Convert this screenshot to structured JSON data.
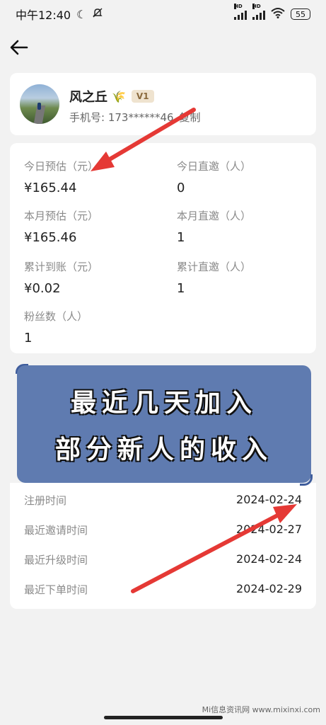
{
  "status_bar": {
    "time": "中午12:40",
    "hd1": "HD",
    "hd2": "HD",
    "battery": "55"
  },
  "profile": {
    "nickname": "风之丘",
    "level": "V1",
    "phone_label": "手机号: 173******46",
    "copy_label": "复制"
  },
  "stats": {
    "today_estimate_label": "今日预估（元）",
    "today_estimate_value": "¥165.44",
    "today_invite_label": "今日直邀（人）",
    "today_invite_value": "0",
    "month_estimate_label": "本月预估（元）",
    "month_estimate_value": "¥165.46",
    "month_invite_label": "本月直邀（人）",
    "month_invite_value": "1",
    "total_arrived_label": "累计到账（元）",
    "total_arrived_value": "¥0.02",
    "total_invite_label": "累计直邀（人）",
    "total_invite_value": "1",
    "fans_label": "粉丝数（人）",
    "fans_value": "1"
  },
  "banner": {
    "line1": "最近几天加入",
    "line2": "部分新人的收入"
  },
  "dates": [
    {
      "label": "注册时间",
      "value": "2024-02-24"
    },
    {
      "label": "最近邀请时间",
      "value": "2024-02-27"
    },
    {
      "label": "最近升级时间",
      "value": "2024-02-24"
    },
    {
      "label": "最近下单时间",
      "value": "2024-02-29"
    }
  ],
  "watermark": "Mi信息资讯网 www.mixinxi.com",
  "colors": {
    "background": "#f2f2f2",
    "card": "#ffffff",
    "banner": "#5f7bb0",
    "arrow": "#e53935",
    "level_badge": "#efe3cf"
  }
}
